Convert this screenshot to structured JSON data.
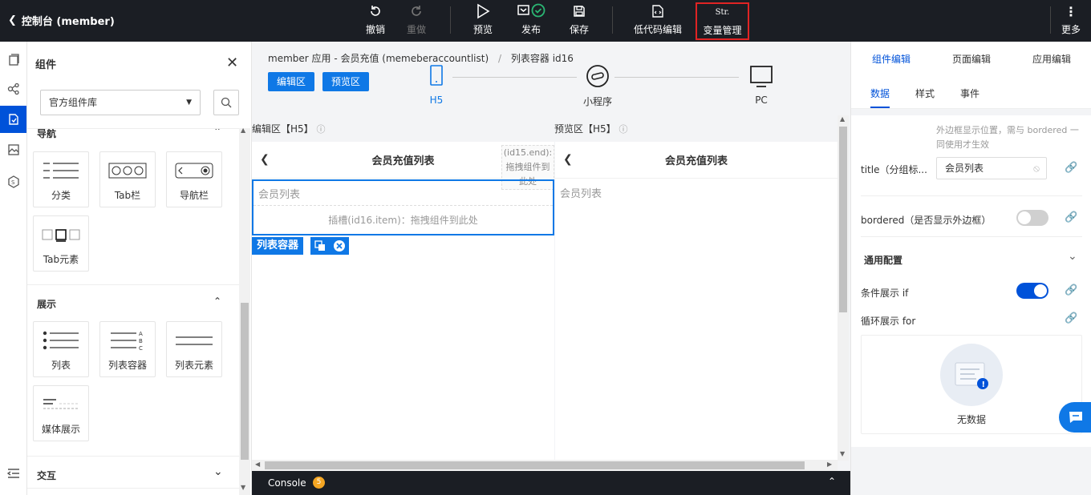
{
  "topbar": {
    "title": "控制台 (member)",
    "buttons": {
      "undo": "撤销",
      "redo": "重做",
      "preview": "预览",
      "publish": "发布",
      "save": "保存",
      "lowcode": "低代码编辑",
      "vars_icon_text": "Str.",
      "vars": "变量管理",
      "more": "更多"
    }
  },
  "left_panel": {
    "title": "组件",
    "library_select": "官方组件库",
    "sections": {
      "nav": {
        "title": "导航",
        "items": [
          "分类",
          "Tab栏",
          "导航栏",
          "Tab元素"
        ]
      },
      "display": {
        "title": "展示",
        "items": [
          "列表",
          "列表容器",
          "列表元素",
          "媒体展示"
        ]
      },
      "interact": {
        "title": "交互"
      }
    }
  },
  "editor": {
    "breadcrumb_app": "member 应用 - 会员充值 (memeberaccountlist)",
    "breadcrumb_sep": "/",
    "breadcrumb_node": "列表容器 id16",
    "edit_btn": "编辑区",
    "preview_btn": "预览区",
    "devices": [
      "H5",
      "小程序",
      "PC"
    ],
    "edit_area_label": "编辑区【H5】",
    "preview_area_label": "预览区【H5】",
    "page_title": "会员充值列表",
    "slot_end_hint": "(id15.end): 拖拽组件到此处",
    "list_title": "会员列表",
    "slot_item_hint": "插槽(id16.item)：拖拽组件到此处",
    "selected_tag": "列表容器",
    "console_label": "Console",
    "console_count": "5"
  },
  "right_panel": {
    "tabs": [
      "组件编辑",
      "页面编辑",
      "应用编辑"
    ],
    "subtabs": [
      "数据",
      "样式",
      "事件"
    ],
    "bordered_hint": "外边框显示位置，需与 bordered 一同使用才生效",
    "title_label": "title（分组标...",
    "title_value": "会员列表",
    "bordered_label": "bordered（是否显示外边框）",
    "general_config": "通用配置",
    "if_label": "条件展示 if",
    "for_label": "循环展示 for",
    "no_data": "无数据",
    "bordered_on": false,
    "if_on": true
  },
  "colors": {
    "accent": "#0052d9",
    "topbar": "#1b1e24",
    "highlight": "#e02424",
    "button_blue": "#0f78e6"
  }
}
